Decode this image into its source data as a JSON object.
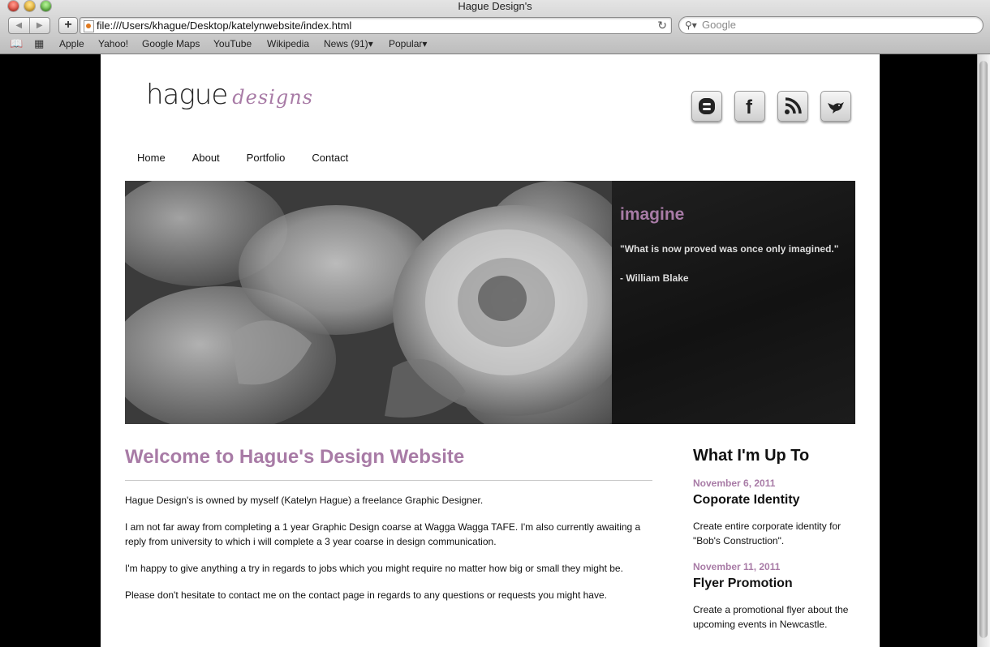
{
  "window": {
    "title": "Hague Design's"
  },
  "browser": {
    "url": "file:///Users/khague/Desktop/katelynwebsite/index.html",
    "search_placeholder": "Google",
    "bookmarks": [
      "Apple",
      "Yahoo!",
      "Google Maps",
      "YouTube",
      "Wikipedia",
      "News (91)",
      "Popular"
    ],
    "bookmark_dropdowns": {
      "news": "▾",
      "popular": "▾"
    }
  },
  "site": {
    "logo": {
      "main": "hague",
      "sub": "designs"
    },
    "social": [
      "blogger-icon",
      "facebook-icon",
      "rss-icon",
      "twitter-icon"
    ],
    "nav": [
      "Home",
      "About",
      "Portfolio",
      "Contact"
    ],
    "hero": {
      "heading": "imagine",
      "quote": "\"What is now proved was once only imagined.\"",
      "author": "- William Blake"
    },
    "welcome": {
      "title": "Welcome to Hague's Design Website",
      "paragraphs": [
        "Hague Design's is owned by myself (Katelyn Hague) a freelance Graphic Designer.",
        "I am not far away from completing a 1 year Graphic Design coarse at Wagga Wagga TAFE. I'm also currently awaiting a reply from university to which i will complete a 3 year coarse in design communication.",
        "I'm happy to give anything a try in regards to jobs which you might require no matter how big or small they might be.",
        "Please don't hesitate to contact me on the contact page in regards to any questions or requests you might have."
      ]
    },
    "sidebar": {
      "title": "What I'm Up To",
      "items": [
        {
          "date": "November 6, 2011",
          "title": "Coporate Identity",
          "body": "Create entire corporate identity for \"Bob's Construction\"."
        },
        {
          "date": "November 11, 2011",
          "title": "Flyer Promotion",
          "body": "Create a promotional flyer about the upcoming events in Newcastle."
        }
      ]
    }
  },
  "colors": {
    "accent": "#a87ba6",
    "text": "#111111",
    "page_bg": "#000000"
  }
}
